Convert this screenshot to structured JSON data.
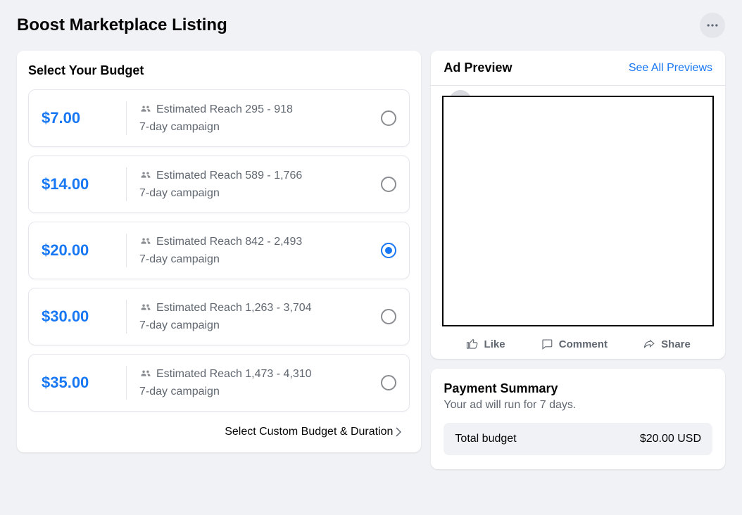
{
  "page_title": "Boost Marketplace Listing",
  "budget_card": {
    "title": "Select Your Budget",
    "options": [
      {
        "price": "$7.00",
        "reach": "Estimated Reach 295 - 918",
        "duration": "7-day campaign",
        "selected": false
      },
      {
        "price": "$14.00",
        "reach": "Estimated Reach 589 - 1,766",
        "duration": "7-day campaign",
        "selected": false
      },
      {
        "price": "$20.00",
        "reach": "Estimated Reach 842 - 2,493",
        "duration": "7-day campaign",
        "selected": true
      },
      {
        "price": "$30.00",
        "reach": "Estimated Reach 1,263 - 3,704",
        "duration": "7-day campaign",
        "selected": false
      },
      {
        "price": "$35.00",
        "reach": "Estimated Reach 1,473 - 4,310",
        "duration": "7-day campaign",
        "selected": false
      }
    ],
    "custom_link": "Select Custom Budget & Duration"
  },
  "preview_card": {
    "title": "Ad Preview",
    "see_all": "See All Previews",
    "actions": {
      "like": "Like",
      "comment": "Comment",
      "share": "Share"
    }
  },
  "summary_card": {
    "title": "Payment Summary",
    "subtitle": "Your ad will run for 7 days.",
    "total_label": "Total budget",
    "total_value": "$20.00 USD"
  },
  "colors": {
    "accent": "#1877f2"
  }
}
